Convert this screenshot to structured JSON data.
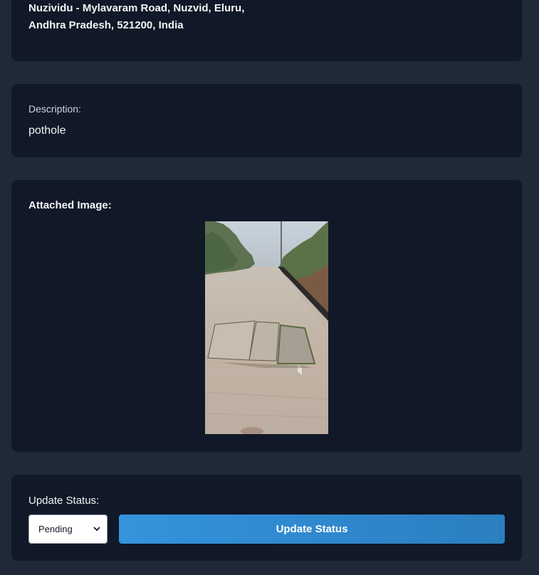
{
  "address": {
    "line1": "Nuzividu - Mylavaram Road, Nuzvid, Eluru,",
    "line2": "Andhra Pradesh, 521200, India"
  },
  "description": {
    "label": "Description:",
    "value": "pothole"
  },
  "attachment": {
    "label": "Attached Image:"
  },
  "status": {
    "label": "Update Status:",
    "selected": "Pending",
    "button_label": "Update Status"
  },
  "colors": {
    "page_bg": "#1f2937",
    "card_bg": "#111827",
    "button_accent": "#3494dc"
  }
}
